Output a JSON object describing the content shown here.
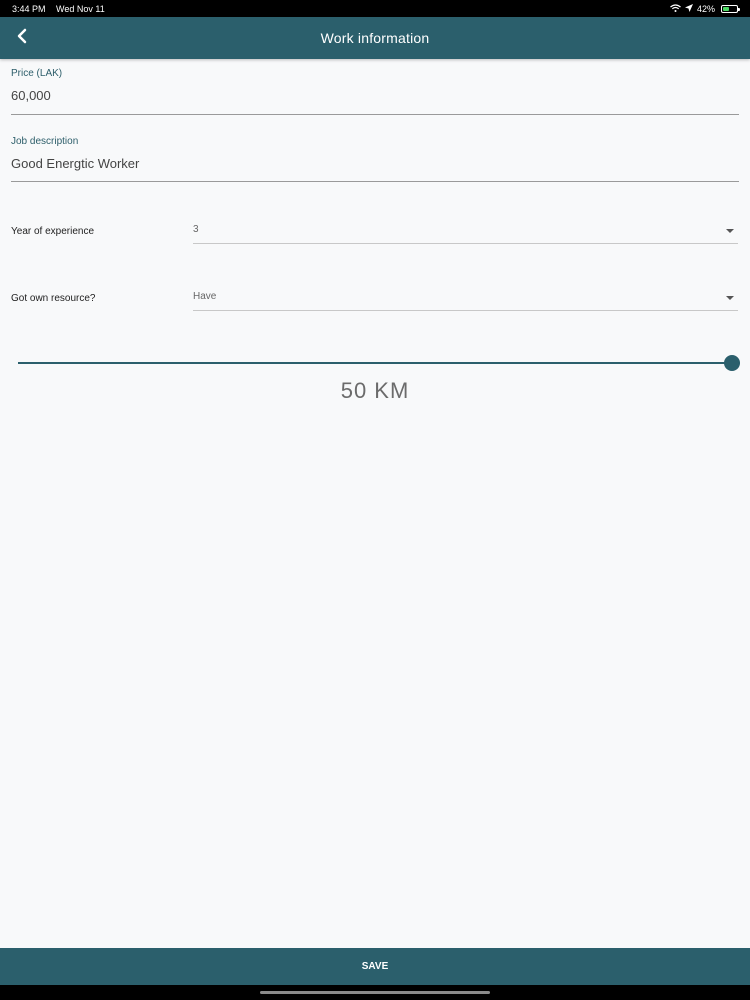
{
  "status_bar": {
    "time": "3:44 PM",
    "date": "Wed Nov 11",
    "wifi_icon": "wifi-icon",
    "location_icon": "location-arrow-icon",
    "battery": "42%",
    "battery_level": 0.42,
    "battery_icon": "battery-icon"
  },
  "nav": {
    "title": "Work information",
    "back_icon": "chevron-left-icon"
  },
  "price": {
    "label": "Price (LAK)",
    "value": "60,000"
  },
  "job_description": {
    "label": "Job description",
    "value": "Good Energtic Worker"
  },
  "experience": {
    "label": "Year of experience",
    "value": "3"
  },
  "resource": {
    "label": "Got own resource?",
    "value": "Have"
  },
  "distance": {
    "level": 1.0,
    "display": "50 KM"
  },
  "footer": {
    "save_label": "SAVE"
  },
  "colors": {
    "primary": "#2b5f6c",
    "background": "#f8f9fa"
  }
}
